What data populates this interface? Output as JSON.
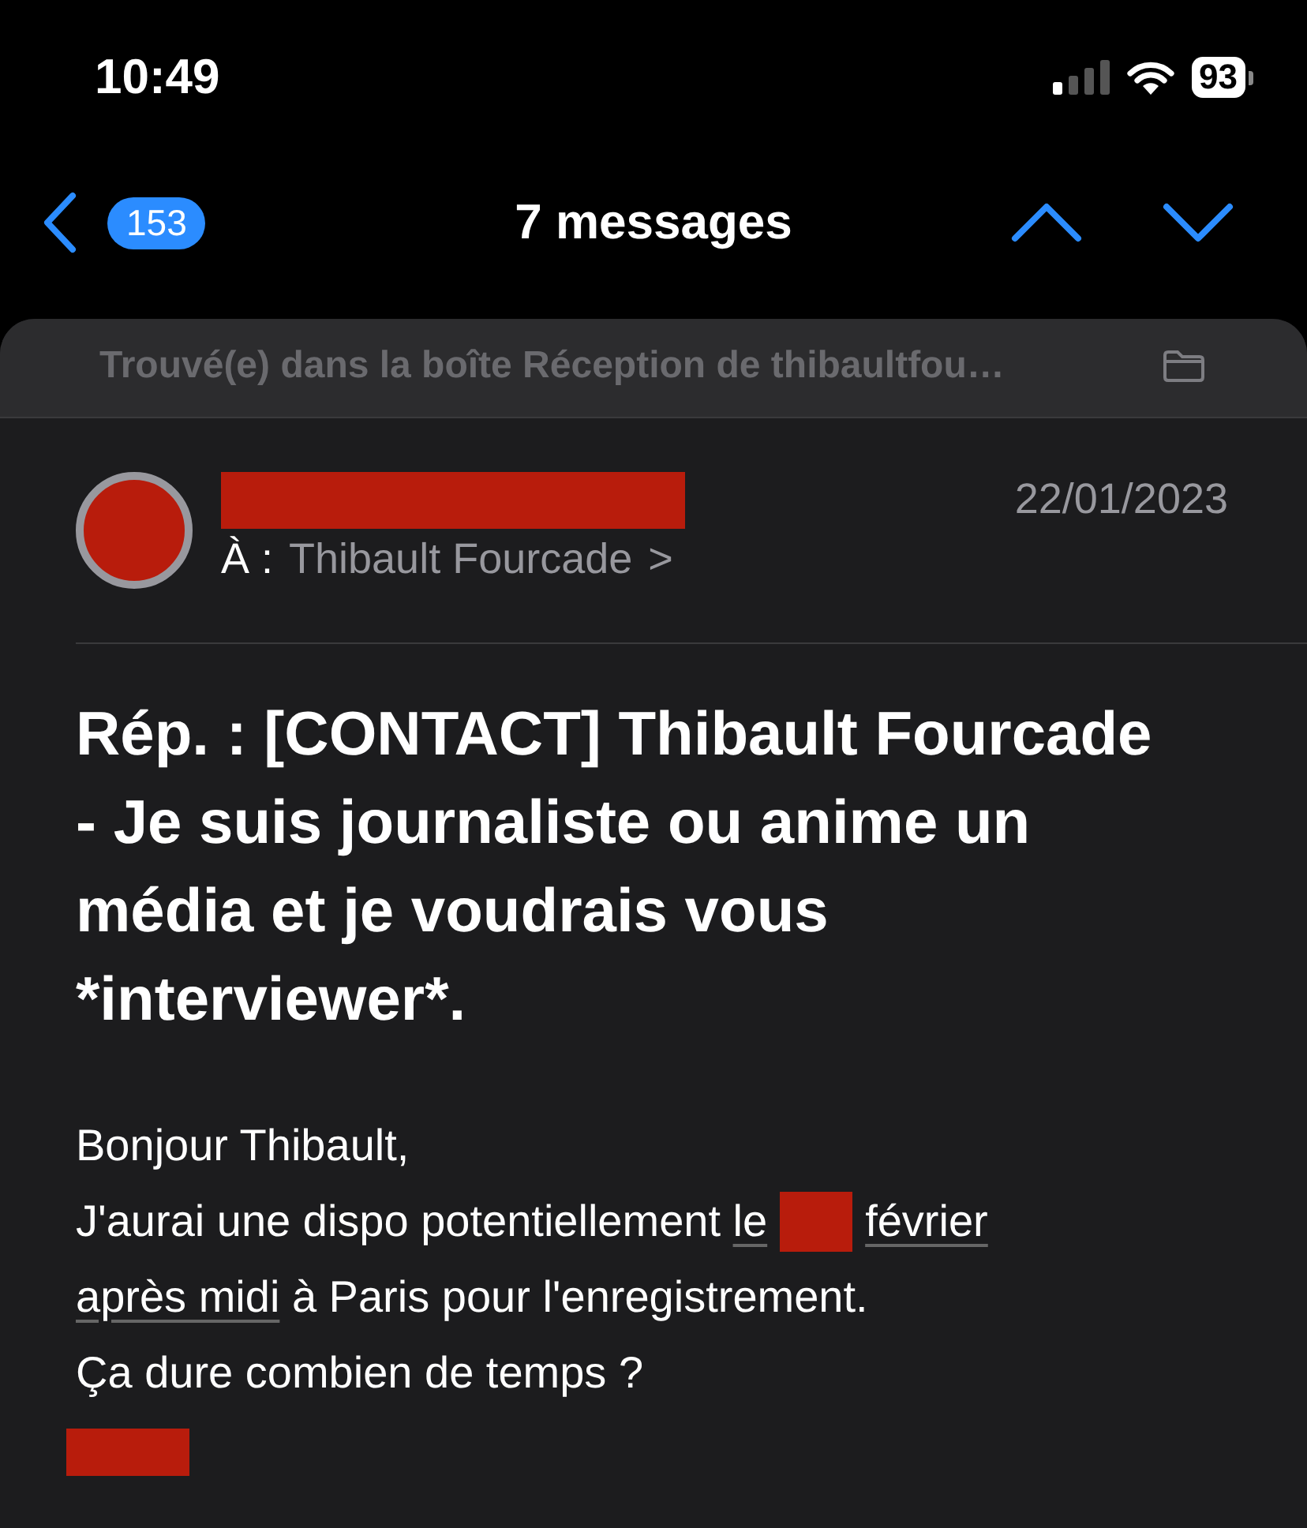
{
  "status_bar": {
    "time": "10:49",
    "battery": "93"
  },
  "nav": {
    "unread_count": "153",
    "title": "7 messages"
  },
  "banner": {
    "text": "Trouvé(e) dans la boîte Réception de thibaultfou…"
  },
  "message": {
    "to_label": "À :",
    "recipient": "Thibault Fourcade",
    "chevron": ">",
    "date": "22/01/2023",
    "subject": "Rép. : [CONTACT] Thibault Fourcade - Je suis journaliste ou anime un média et je voudrais vous *interviewer*.",
    "body": [
      {
        "parts": [
          {
            "kind": "text",
            "text": "Bonjour Thibault,"
          }
        ]
      },
      {
        "parts": [
          {
            "kind": "text",
            "text": "J'aurai une dispo potentiellement "
          },
          {
            "kind": "link",
            "pieces": [
              {
                "kind": "text",
                "text": "le"
              },
              {
                "kind": "redaction"
              },
              {
                "kind": "text",
                "text": "février"
              }
            ]
          }
        ]
      },
      {
        "parts": [
          {
            "kind": "link",
            "pieces": [
              {
                "kind": "text",
                "text": "après midi"
              }
            ]
          },
          {
            "kind": "text",
            "text": " à Paris pour l'enregistrement."
          }
        ]
      },
      {
        "parts": [
          {
            "kind": "text",
            "text": "Ça dure combien de temps ?"
          }
        ]
      },
      {
        "parts": [
          {
            "kind": "redaction"
          }
        ]
      }
    ]
  }
}
